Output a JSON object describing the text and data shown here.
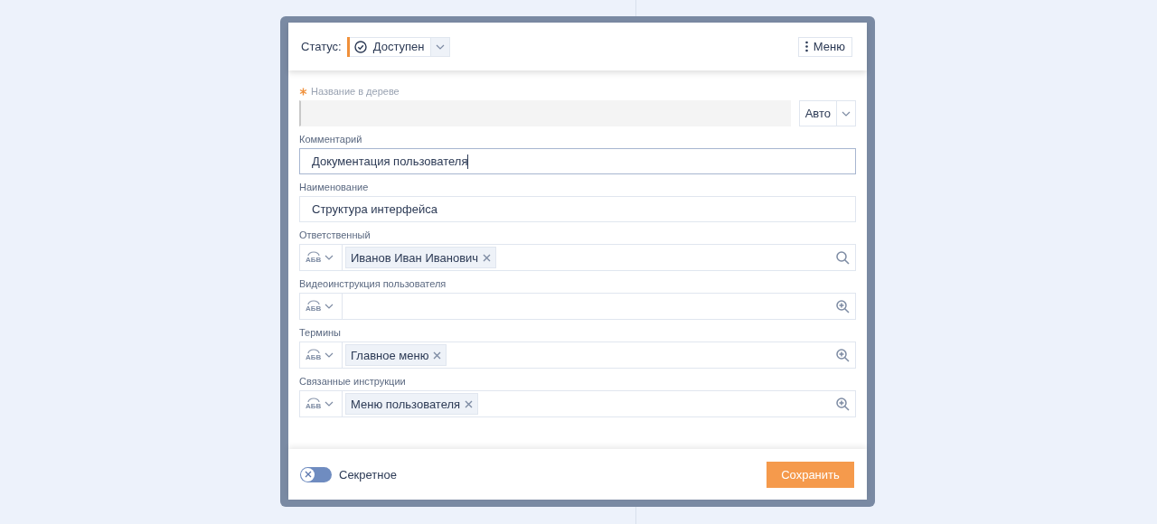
{
  "header": {
    "status_label": "Статус:",
    "status": {
      "value": "Доступен",
      "color": "#f0903a"
    },
    "menu_button": "Меню"
  },
  "fields": [
    {
      "kind": "tree_name",
      "label": "Название в дереве",
      "required": true,
      "disabled": true,
      "mode": "Авто"
    },
    {
      "kind": "text",
      "label": "Комментарий",
      "value": "Документация пользователя",
      "focused": true
    },
    {
      "kind": "text",
      "label": "Наименование",
      "value": "Структура интерфейса",
      "focused": false
    },
    {
      "kind": "lookup",
      "label": "Ответственный",
      "mode_label": "АБВ",
      "tags": [
        "Иванов Иван Иванович"
      ],
      "search_plus": false
    },
    {
      "kind": "lookup",
      "label": "Видеоинструкция пользователя",
      "mode_label": "АБВ",
      "search_plus": true
    },
    {
      "kind": "lookup",
      "label": "Термины",
      "mode_label": "АБВ",
      "tags": [
        "Главное меню"
      ],
      "search_plus": true
    },
    {
      "kind": "lookup",
      "label": "Связанные инструкции",
      "mode_label": "АБВ",
      "tags": [
        "Меню пользователя"
      ],
      "search_plus": true
    }
  ],
  "footer": {
    "secret": {
      "label": "Секретное",
      "on": false
    },
    "save_button": "Сохранить"
  }
}
